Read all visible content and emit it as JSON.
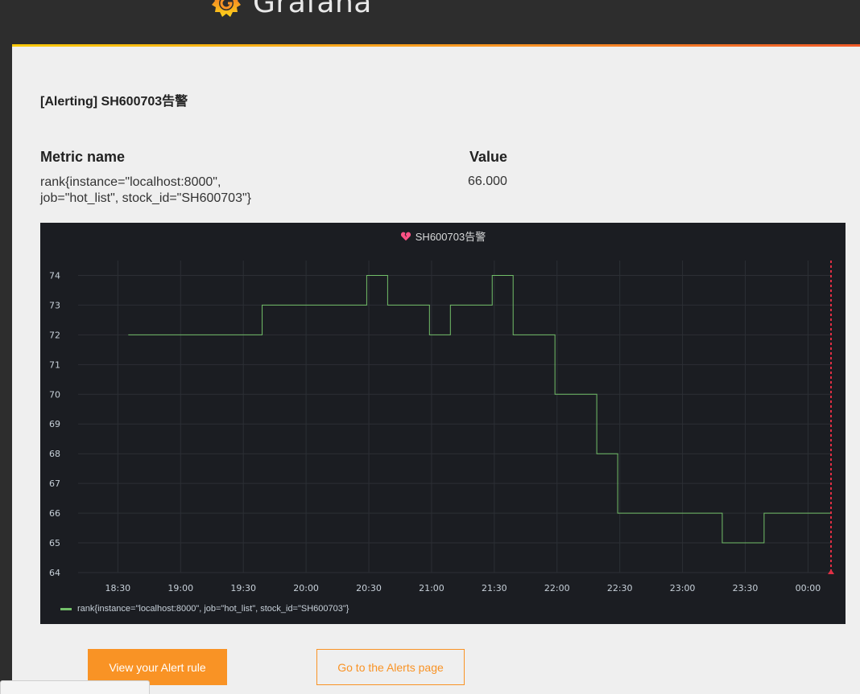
{
  "header": {
    "brand_name": "Grafana",
    "logo_icon": "grafana-logo-icon",
    "accent_colors": [
      "#fbca0a",
      "#f99325",
      "#f05a28"
    ]
  },
  "email": {
    "title": "[Alerting] SH600703告警",
    "metric_col_label": "Metric name",
    "value_col_label": "Value",
    "metric_name": "rank{instance=\"localhost:8000\", job=\"hot_list\", stock_id=\"SH600703\"}",
    "metric_value": "66.000"
  },
  "panel": {
    "title": "SH600703告警",
    "state_icon": "broken-heart-icon",
    "alert_color": "#ff5286"
  },
  "chart_data": {
    "type": "line",
    "title": "SH600703告警",
    "step": true,
    "grid": true,
    "ylim": [
      64,
      74.5
    ],
    "y_ticks": [
      "64",
      "65",
      "66",
      "67",
      "68",
      "69",
      "70",
      "71",
      "72",
      "73",
      "74"
    ],
    "x_ticks": [
      "18:30",
      "19:00",
      "19:30",
      "20:00",
      "20:30",
      "21:00",
      "21:30",
      "22:00",
      "22:30",
      "23:00",
      "23:30",
      "00:00"
    ],
    "series": [
      {
        "name": "rank{instance=\"localhost:8000\", job=\"hot_list\", stock_id=\"SH600703\"}",
        "color": "#73bf69",
        "points": [
          [
            "18:35",
            72
          ],
          [
            "19:39",
            73
          ],
          [
            "20:29",
            74
          ],
          [
            "20:39",
            73
          ],
          [
            "20:59",
            72
          ],
          [
            "21:09",
            73
          ],
          [
            "21:29",
            74
          ],
          [
            "21:39",
            72
          ],
          [
            "21:59",
            70
          ],
          [
            "22:19",
            68
          ],
          [
            "22:29",
            66
          ],
          [
            "23:19",
            65
          ],
          [
            "23:39",
            66
          ],
          [
            "00:11",
            66
          ]
        ]
      }
    ],
    "threshold_time": "00:11",
    "threshold_color": "#e02f44"
  },
  "actions": {
    "view_rule_label": "View your Alert rule",
    "alerts_page_label": "Go to the Alerts page"
  }
}
